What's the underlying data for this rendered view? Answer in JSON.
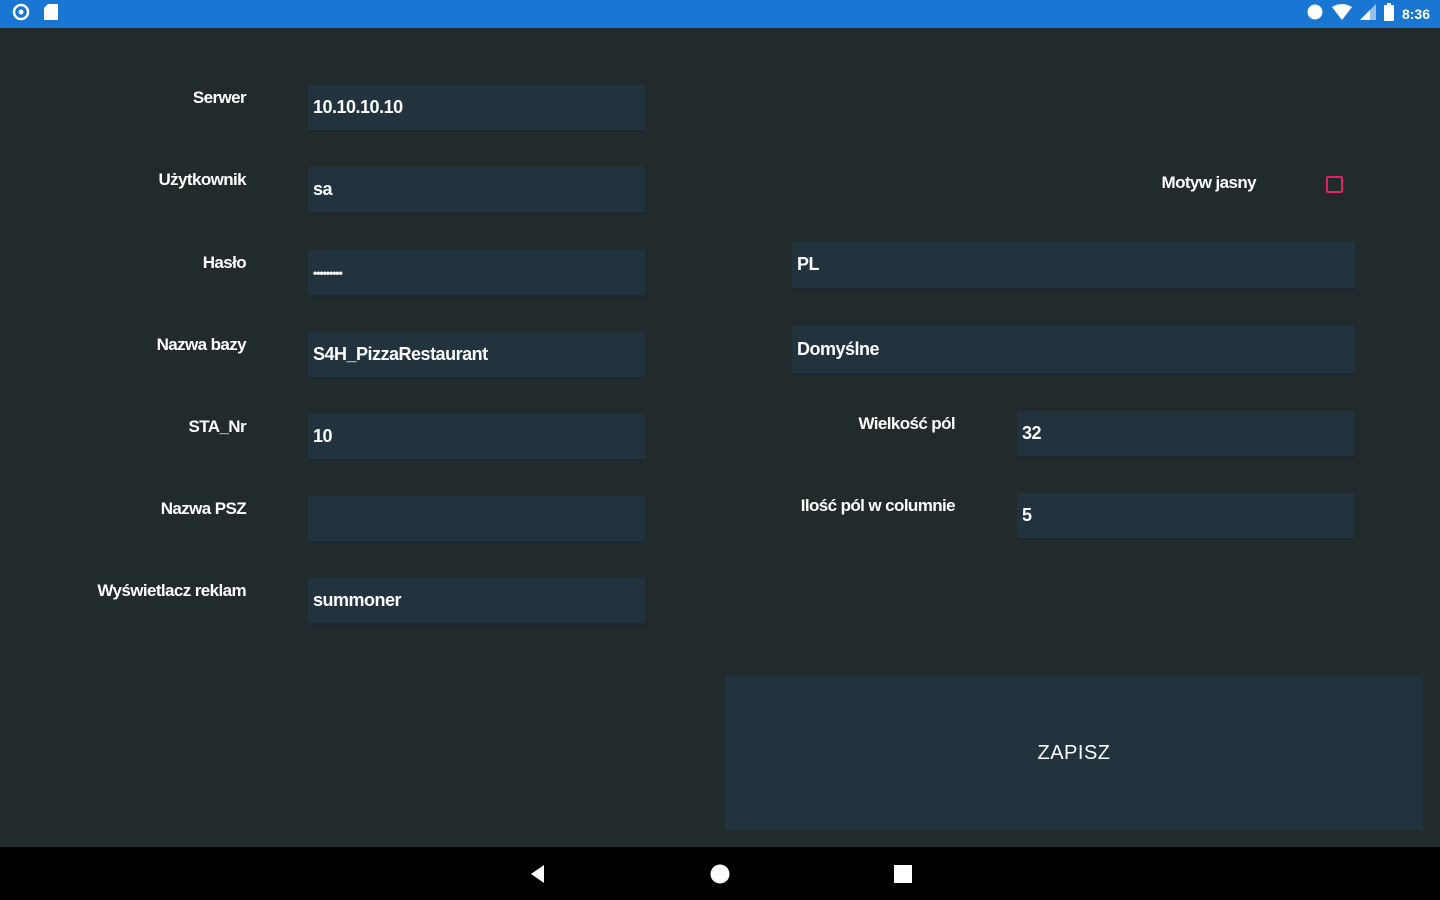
{
  "status_bar": {
    "time": "8:36",
    "left_icons": [
      "settings-circle-icon",
      "sd-card-icon"
    ],
    "right_icons": [
      "circle-icon",
      "wifi-icon",
      "signal-icon",
      "battery-icon"
    ],
    "background": "#1976d2"
  },
  "form": {
    "server": {
      "label": "Serwer",
      "value": "10.10.10.10"
    },
    "user": {
      "label": "Użytkownik",
      "value": "sa"
    },
    "password": {
      "label": "Hasło",
      "value": "•••••••••"
    },
    "database": {
      "label": "Nazwa bazy",
      "value": "S4H_PizzaRestaurant"
    },
    "sta_nr": {
      "label": "STA_Nr",
      "value": "10"
    },
    "psz_name": {
      "label": "Nazwa PSZ",
      "value": ""
    },
    "ad_display": {
      "label": "Wyświetlacz reklam",
      "value": "summoner"
    }
  },
  "settings": {
    "light_theme": {
      "label": "Motyw jasny",
      "checked": false
    },
    "language": {
      "value": "PL"
    },
    "default": {
      "value": "Domyślne"
    },
    "field_size": {
      "label": "Wielkość pól",
      "value": "32"
    },
    "fields_per_column": {
      "label": "Ilość pól w columnie",
      "value": "5"
    }
  },
  "save_button": {
    "label": "ZAPISZ"
  },
  "nav_bar": {
    "buttons": [
      "back-icon",
      "home-icon",
      "recents-icon"
    ]
  },
  "colors": {
    "background": "#212b2c",
    "field": "#22333e",
    "checkbox_accent": "#e91e63"
  }
}
